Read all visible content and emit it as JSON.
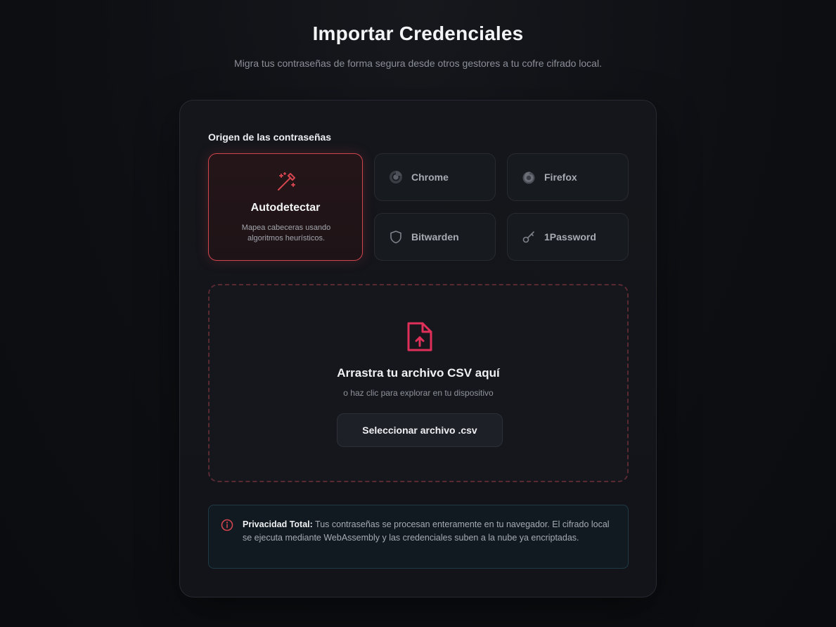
{
  "header": {
    "title": "Importar Credenciales",
    "subtitle": "Migra tus contraseñas de forma segura desde otros gestores a tu cofre cifrado local."
  },
  "sources": {
    "label": "Origen de las contraseñas",
    "selected": {
      "title": "Autodetectar",
      "description": "Mapea cabeceras usando algoritmos heurísticos.",
      "icon": "magic-wand-icon"
    },
    "options": [
      {
        "label": "Chrome",
        "icon": "chrome-icon"
      },
      {
        "label": "Firefox",
        "icon": "firefox-icon"
      },
      {
        "label": "Bitwarden",
        "icon": "shield-icon"
      },
      {
        "label": "1Password",
        "icon": "key-icon"
      }
    ]
  },
  "dropzone": {
    "title": "Arrastra tu archivo CSV aquí",
    "subtitle": "o haz clic para explorar en tu dispositivo",
    "button": "Seleccionar archivo .csv",
    "icon": "file-upload-icon"
  },
  "privacy": {
    "title": "Privacidad Total:",
    "text": " Tus contraseñas se procesan enteramente en tu navegador. El cifrado local se ejecuta mediante WebAssembly y las credenciales suben a la nube ya encriptadas.",
    "icon": "info-icon"
  },
  "colors": {
    "accent": "#d2454f",
    "accent_pink": "#e0305a",
    "background": "#0d0f13",
    "card": "#14161b"
  }
}
